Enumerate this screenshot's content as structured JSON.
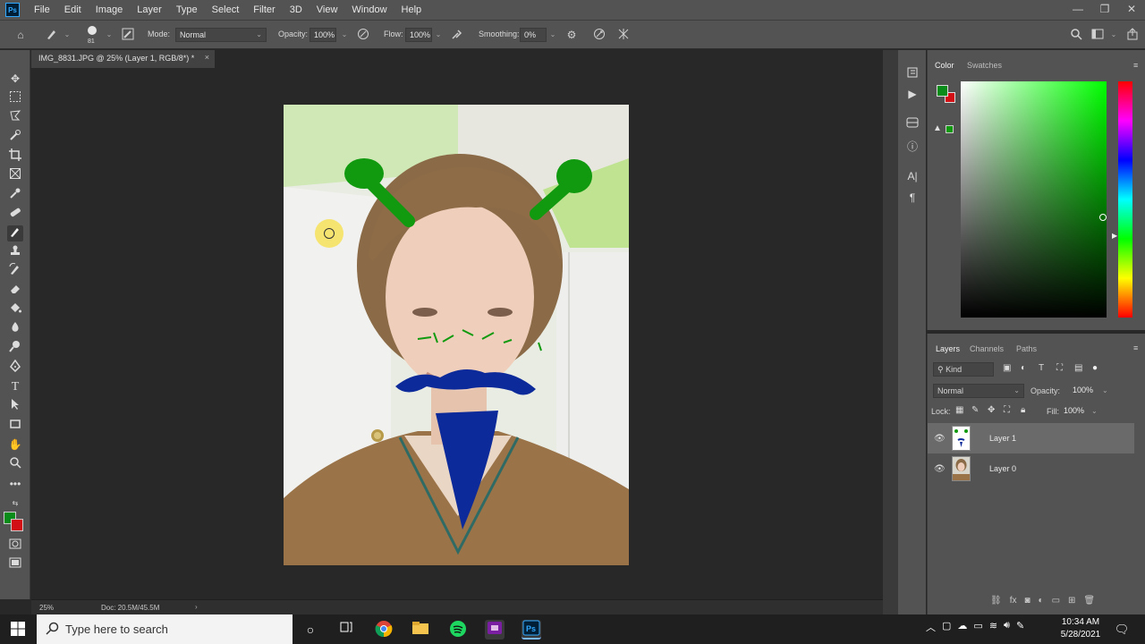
{
  "menubar": {
    "app_logo": "Ps",
    "items": [
      "File",
      "Edit",
      "Image",
      "Layer",
      "Type",
      "Select",
      "Filter",
      "3D",
      "View",
      "Window",
      "Help"
    ]
  },
  "window_controls": {
    "minimize": "—",
    "restore": "❐",
    "close": "✕"
  },
  "options": {
    "brush_size": "81",
    "mode_label": "Mode:",
    "mode_value": "Normal",
    "opacity_label": "Opacity:",
    "opacity_value": "100%",
    "flow_label": "Flow:",
    "flow_value": "100%",
    "smoothing_label": "Smoothing:",
    "smoothing_value": "0%"
  },
  "document": {
    "tab_title": "IMG_8831.JPG @ 25% (Layer 1, RGB/8*) *",
    "zoom": "25%",
    "doc_size": "Doc: 20.5M/45.5M"
  },
  "colors": {
    "foreground": "#0a8c1a",
    "background": "#d10f14",
    "picker_hue": "#00ff00",
    "paint_green": "#119a10",
    "paint_blue": "#0c2a9a"
  },
  "color_panel": {
    "tabs": [
      "Color",
      "Swatches"
    ]
  },
  "layers_panel": {
    "tabs": [
      "Layers",
      "Channels",
      "Paths"
    ],
    "filter_kind": "Kind",
    "blend_mode": "Normal",
    "opacity_label": "Opacity:",
    "opacity_value": "100%",
    "lock_label": "Lock:",
    "fill_label": "Fill:",
    "fill_value": "100%",
    "layers": [
      {
        "name": "Layer 1",
        "selected": true
      },
      {
        "name": "Layer 0",
        "selected": false
      }
    ]
  },
  "taskbar": {
    "search_placeholder": "Type here to search",
    "time": "10:34 AM",
    "date": "5/28/2021"
  }
}
